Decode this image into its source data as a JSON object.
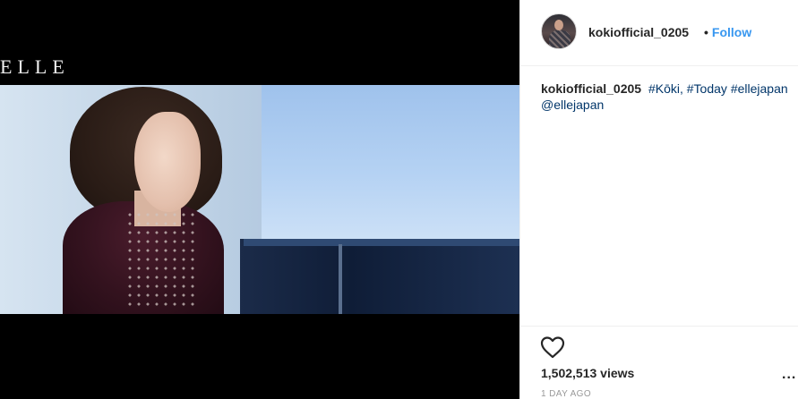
{
  "media": {
    "watermark": "ELLE"
  },
  "header": {
    "username": "kokiofficial_0205",
    "separator": "•",
    "follow_label": "Follow"
  },
  "caption": {
    "username": "kokiofficial_0205",
    "tags": [
      "#Kōki,",
      "#Today",
      "#ellejapan",
      "@ellejapan"
    ]
  },
  "footer": {
    "views": "1,502,513 views",
    "timestamp": "1 DAY AGO",
    "more_label": "..."
  },
  "icons": {
    "like": "heart-icon",
    "more": "more-options-icon",
    "avatar": "avatar"
  },
  "colors": {
    "link": "#3897f0",
    "hashtag": "#003569",
    "muted": "#999999",
    "text": "#262626",
    "border": "#efefef"
  }
}
